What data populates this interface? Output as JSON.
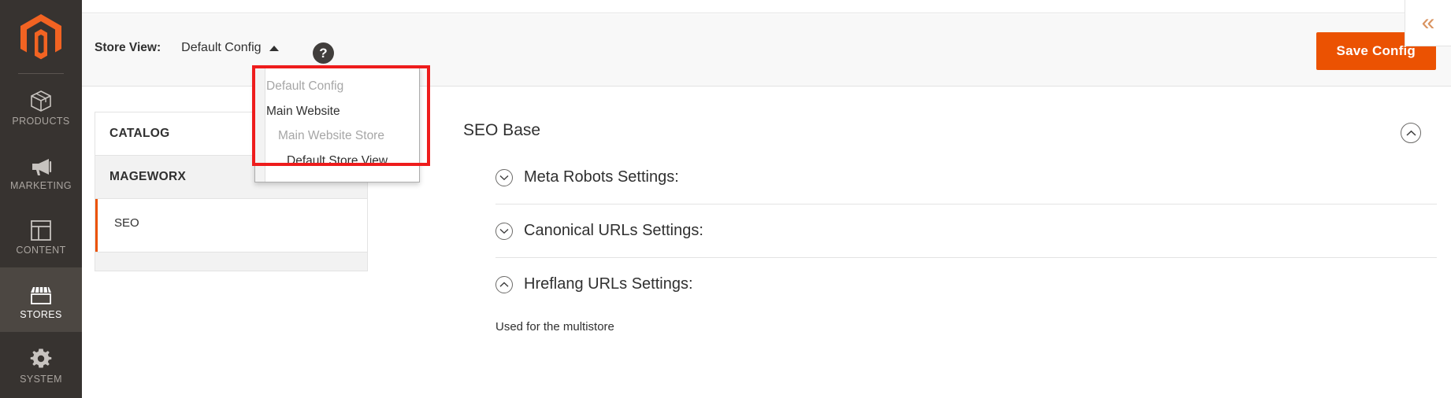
{
  "sidebar": {
    "logo_name": "magento-logo-icon",
    "items": [
      {
        "label": "PRODUCTS",
        "icon": "box-icon",
        "active": false
      },
      {
        "label": "MARKETING",
        "icon": "megaphone-icon",
        "active": false
      },
      {
        "label": "CONTENT",
        "icon": "layout-icon",
        "active": false
      },
      {
        "label": "STORES",
        "icon": "storefront-icon",
        "active": true
      },
      {
        "label": "SYSTEM",
        "icon": "gear-icon",
        "active": false
      }
    ]
  },
  "header": {
    "store_view_label": "Store View:",
    "store_view_value": "Default Config",
    "caret_icon": "caret-up-icon",
    "help_icon": "question-mark-icon",
    "help_text": "?",
    "save_label": "Save Config",
    "collapse_icon": "double-chevron-left-icon",
    "collapse_glyph": "«"
  },
  "store_dropdown": {
    "items": [
      {
        "label": "Default Config",
        "level": 1,
        "state": "muted"
      },
      {
        "label": "Main Website",
        "level": 1,
        "state": "dark"
      },
      {
        "label": "Main Website Store",
        "level": 2,
        "state": "muted"
      },
      {
        "label": "Default Store View",
        "level": 3,
        "state": "dark"
      }
    ]
  },
  "config_nav": {
    "sections": [
      {
        "title": "CATALOG",
        "chevron": "chevron-down-icon"
      },
      {
        "title": "MAGEWORX",
        "chevron": "chevron-up-icon"
      }
    ],
    "items": [
      {
        "label": "SEO",
        "selected": true
      }
    ]
  },
  "content": {
    "page_title": "SEO Base",
    "collapse_icon": "circle-chevron-up-icon",
    "groups": [
      {
        "title": "Meta Robots Settings:",
        "icon": "circle-chevron-down-icon",
        "expanded": false
      },
      {
        "title": "Canonical URLs Settings:",
        "icon": "circle-chevron-down-icon",
        "expanded": false
      },
      {
        "title": "Hreflang URLs Settings:",
        "icon": "circle-chevron-up-icon",
        "expanded": true
      }
    ],
    "note": "Used for the multistore"
  },
  "colors": {
    "brand_orange": "#eb5202",
    "sidebar_bg": "#373330",
    "annotation_red": "#ee1c1c"
  }
}
